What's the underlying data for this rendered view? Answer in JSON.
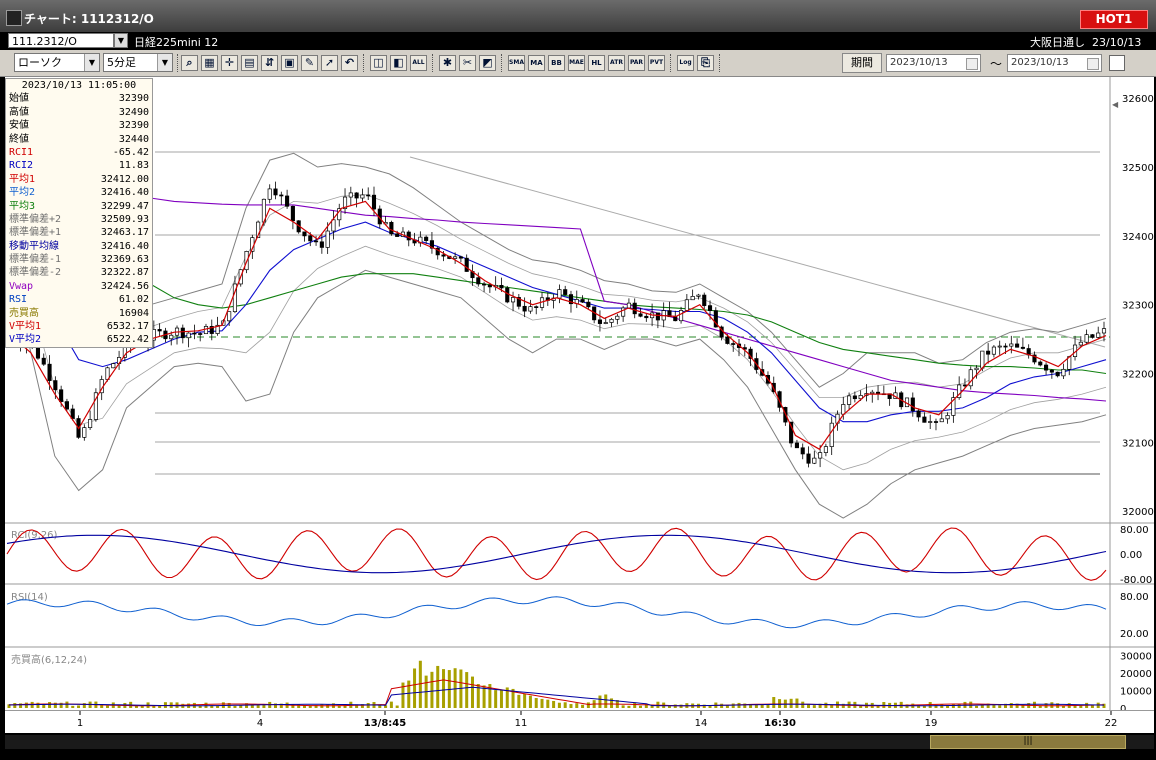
{
  "window": {
    "title": "チャート: 1112312/O",
    "hot_label": "HOT1"
  },
  "infobar": {
    "symbol_code": "111.2312/O",
    "symbol_name": "日経225mini 12",
    "market_label": "大阪日通し",
    "market_date": "23/10/13"
  },
  "toolbar": {
    "chart_type": "ローソク",
    "interval": "5分足",
    "buttons": [
      "zoom",
      "grid",
      "cross",
      "panel",
      "bb",
      "calc",
      "draw",
      "select",
      "undo",
      "box1",
      "box2",
      "ALL",
      "tool",
      "clear",
      "color",
      "SMA",
      "MA",
      "BB",
      "MAE",
      "HL",
      "ATR",
      "PAR",
      "PVT",
      "Log",
      "copy"
    ],
    "period_label": "期間",
    "date_from": "2023/10/13",
    "date_to": "2023/10/13"
  },
  "info_panel": {
    "timestamp": "2023/10/13 11:05:00",
    "rows": [
      {
        "label": "始値",
        "value": "32390",
        "color": "#000000"
      },
      {
        "label": "高値",
        "value": "32490",
        "color": "#000000"
      },
      {
        "label": "安値",
        "value": "32390",
        "color": "#000000"
      },
      {
        "label": "終値",
        "value": "32440",
        "color": "#000000"
      },
      {
        "label": "RCI1",
        "value": "-65.42",
        "color": "#d00000"
      },
      {
        "label": "RCI2",
        "value": "11.83",
        "color": "#0000c0"
      },
      {
        "label": "平均1",
        "value": "32412.00",
        "color": "#d00000"
      },
      {
        "label": "平均2",
        "value": "32416.40",
        "color": "#1060d0"
      },
      {
        "label": "平均3",
        "value": "32299.47",
        "color": "#108010"
      },
      {
        "label": "標準偏差+2",
        "value": "32509.93",
        "color": "#707070"
      },
      {
        "label": "標準偏差+1",
        "value": "32463.17",
        "color": "#707070"
      },
      {
        "label": "移動平均線",
        "value": "32416.40",
        "color": "#0000a0"
      },
      {
        "label": "標準偏差-1",
        "value": "32369.63",
        "color": "#707070"
      },
      {
        "label": "標準偏差-2",
        "value": "32322.87",
        "color": "#707070"
      },
      {
        "label": "Vwap",
        "value": "32424.56",
        "color": "#9000c0"
      },
      {
        "label": "RSI",
        "value": "61.02",
        "color": "#0040c0"
      },
      {
        "label": "売買高",
        "value": "16904",
        "color": "#8a7a00"
      },
      {
        "label": "V平均1",
        "value": "6532.17",
        "color": "#d00000"
      },
      {
        "label": "V平均2",
        "value": "6522.42",
        "color": "#0000c0"
      }
    ]
  },
  "price_axis": {
    "labels": [
      "32600",
      "32500",
      "32400",
      "32300",
      "32200",
      "32100",
      "32000"
    ],
    "values": [
      32600,
      32500,
      32400,
      32300,
      32200,
      32100,
      32000
    ],
    "min": 31990,
    "max": 32625
  },
  "dashed_level": 32253,
  "rci_panel": {
    "title": "RCI(9,26)",
    "labels": [
      "80.00",
      "0.00",
      "-80.00"
    ]
  },
  "rsi_panel": {
    "title": "RSI(14)",
    "labels": [
      "80.00",
      "20.00"
    ]
  },
  "volume_panel": {
    "title": "売買高(6,12,24)",
    "labels": [
      "30000",
      "20000",
      "10000",
      "0"
    ]
  },
  "x_axis": {
    "labels": [
      "1",
      "4",
      "13/8:45",
      "11",
      "14",
      "16:30",
      "19",
      "22"
    ]
  },
  "colors": {
    "up": "#ffffff",
    "down": "#000000",
    "sma1": "#d00000",
    "sma2": "#1010d0",
    "sma3": "#108010",
    "bb": "#808080",
    "vwap": "#8000c0",
    "volume": "#a8a000",
    "rci1": "#d00000",
    "rci2": "#0000a0",
    "rsi": "#1060d0"
  },
  "chart_data": {
    "type": "line",
    "x": [
      0,
      24,
      48,
      72,
      96,
      120,
      144,
      168,
      192,
      216,
      240,
      264,
      288,
      312,
      336,
      360,
      384,
      408,
      432,
      456,
      480,
      504,
      528,
      552,
      576,
      600,
      624,
      648,
      672,
      696,
      720,
      744,
      768,
      792,
      816,
      840,
      864,
      888,
      912,
      936,
      960,
      984,
      1008,
      1032,
      1056,
      1080,
      1104
    ],
    "series": [
      {
        "name": "終値",
        "values": [
          32255,
          32240,
          32180,
          32100,
          32200,
          32240,
          32255,
          32262,
          32258,
          32270,
          32380,
          32480,
          32420,
          32380,
          32450,
          32460,
          32400,
          32395,
          32380,
          32360,
          32330,
          32310,
          32290,
          32320,
          32300,
          32270,
          32300,
          32285,
          32280,
          32320,
          32255,
          32230,
          32180,
          32090,
          32070,
          32160,
          32180,
          32170,
          32150,
          32120,
          32180,
          32230,
          32240,
          32225,
          32200,
          32245,
          32260
        ]
      },
      {
        "name": "平均1",
        "values": [
          32260,
          32230,
          32170,
          32120,
          32180,
          32230,
          32250,
          32260,
          32262,
          32270,
          32360,
          32440,
          32420,
          32395,
          32440,
          32450,
          32410,
          32395,
          32380,
          32360,
          32335,
          32315,
          32300,
          32310,
          32300,
          32280,
          32295,
          32285,
          32283,
          32300,
          32260,
          32230,
          32185,
          32110,
          32090,
          32140,
          32170,
          32170,
          32150,
          32140,
          32175,
          32215,
          32235,
          32225,
          32210,
          32240,
          32255
        ]
      },
      {
        "name": "移動平均線",
        "values": [
          32470,
          32380,
          32280,
          32220,
          32210,
          32220,
          32235,
          32250,
          32260,
          32262,
          32300,
          32350,
          32380,
          32395,
          32410,
          32420,
          32405,
          32395,
          32385,
          32370,
          32355,
          32340,
          32325,
          32315,
          32305,
          32295,
          32295,
          32293,
          32290,
          32290,
          32280,
          32260,
          32230,
          32190,
          32150,
          32130,
          32130,
          32140,
          32145,
          32145,
          32150,
          32165,
          32185,
          32195,
          32200,
          32210,
          32220
        ]
      },
      {
        "name": "平均3",
        "values": [
          32520,
          32480,
          32440,
          32400,
          32370,
          32345,
          32330,
          32310,
          32300,
          32295,
          32300,
          32310,
          32320,
          32330,
          32340,
          32345,
          32345,
          32345,
          32340,
          32335,
          32330,
          32325,
          32320,
          32315,
          32310,
          32305,
          32300,
          32297,
          32295,
          32293,
          32290,
          32285,
          32275,
          32260,
          32245,
          32235,
          32230,
          32225,
          32220,
          32215,
          32212,
          32210,
          32210,
          32208,
          32205,
          32205,
          32200
        ]
      },
      {
        "name": "Vwap",
        "values": [
          32520,
          32500,
          32480,
          32470,
          32465,
          32460,
          32455,
          32450,
          32448,
          32446,
          32445,
          32445,
          32445,
          32440,
          32435,
          32430,
          32428,
          32425,
          32423,
          32420,
          32418,
          32416,
          32414,
          32412,
          32410,
          32305,
          32300,
          32290,
          32280,
          32270,
          32260,
          32250,
          32240,
          32230,
          32220,
          32210,
          32200,
          32190,
          32185,
          32180,
          32175,
          32172,
          32170,
          32168,
          32165,
          32163,
          32160
        ]
      },
      {
        "name": "標準偏差+2",
        "values": [
          32560,
          32500,
          32440,
          32350,
          32300,
          32290,
          32300,
          32310,
          32320,
          32330,
          32440,
          32510,
          32520,
          32500,
          32505,
          32500,
          32490,
          32470,
          32445,
          32420,
          32400,
          32380,
          32365,
          32360,
          32350,
          32335,
          32330,
          32320,
          32318,
          32330,
          32310,
          32290,
          32260,
          32220,
          32180,
          32200,
          32230,
          32230,
          32230,
          32215,
          32220,
          32245,
          32260,
          32265,
          32260,
          32270,
          32280
        ]
      },
      {
        "name": "標準偏差-2",
        "values": [
          32380,
          32230,
          32080,
          32030,
          32060,
          32150,
          32180,
          32210,
          32215,
          32210,
          32160,
          32170,
          32260,
          32310,
          32330,
          32350,
          32340,
          32330,
          32320,
          32310,
          32280,
          32250,
          32230,
          32250,
          32250,
          32235,
          32250,
          32250,
          32240,
          32250,
          32220,
          32180,
          32120,
          32060,
          32010,
          31990,
          32010,
          32040,
          32060,
          32070,
          32080,
          32095,
          32110,
          32120,
          32125,
          32130,
          32140
        ]
      }
    ],
    "ylim": [
      31990,
      32625
    ]
  }
}
